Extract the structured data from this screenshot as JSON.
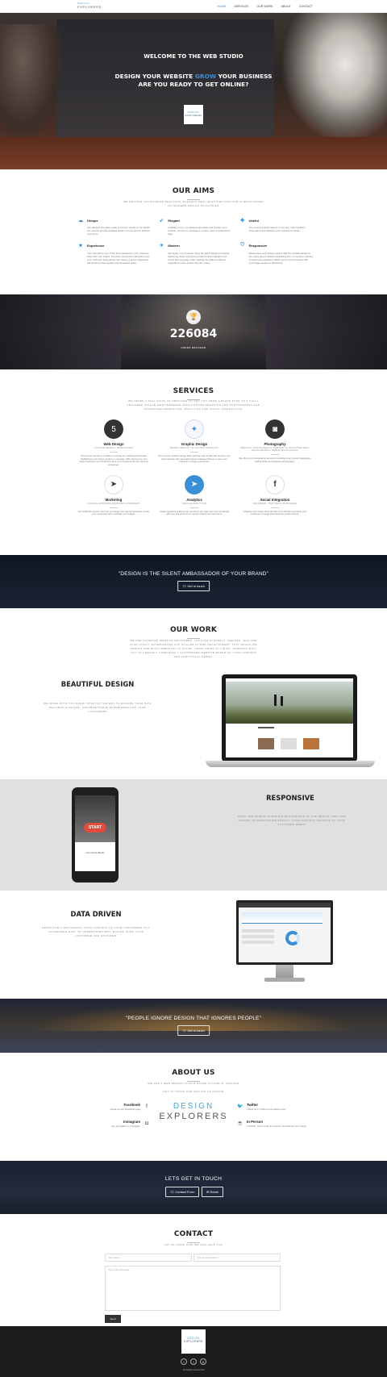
{
  "nav": {
    "logo_line1": "DESIGN",
    "logo_line2": "EXPLORERS",
    "items": [
      "HOME",
      "SERVICES",
      "OUR WORK",
      "ABOUT",
      "CONTACT"
    ]
  },
  "hero": {
    "welcome": "WELCOME TO THE WEB STUDIO",
    "line1_a": "DESIGN YOUR WEBSITE ",
    "line1_hl": "GROW",
    "line1_b": " YOUR BUSINESS",
    "line2": "ARE YOU READY TO GET ONLINE?",
    "logo_line1": "DESIGN",
    "logo_line2": "EXPLORERS"
  },
  "aims": {
    "title": "OUR AIMS",
    "subtitle": "WE DELIVER TAILOR MADE BEAUTIFUL ELEGANT WEB IDENTITIES FOR OUR CLIENTS BASED ON MODERN DESIGN PRINCIPLES",
    "items": [
      {
        "icon": "cloud-icon",
        "title": "Unique",
        "text": "Our designs are tailor made to suit the needs of our clients, our experts provide detailed advice on how best to achieve your aims."
      },
      {
        "icon": "rocket-icon",
        "title": "Elegant",
        "text": "Usability is key, our designs are clean and present your product, service or message in a clear easy to understand way."
      },
      {
        "icon": "useful-icon",
        "title": "Useful",
        "text": "The most important aspect to any site, that it delivers information and satisfies your customers needs."
      },
      {
        "icon": "star-icon",
        "title": "Experience",
        "text": "Your site will be one of the first interactions your customer have with your brand. The user experience will define how your customer feels about your brand. A great experience will develop brand loyalty and increased sales."
      },
      {
        "icon": "plane-icon",
        "title": "Modern",
        "text": "We deploy our products using the latest design principles, delivering clean responsive products that highlight your brand and message while ranking the widest audience regardless of the device they are using."
      },
      {
        "icon": "shield-icon",
        "title": "Responsive",
        "text": "Responsive web design means that the website adapts to the users device without sacrificing form or function. Having a responsive website enables you to communicate with your target audience effectively."
      }
    ]
  },
  "counter": {
    "number": "226084",
    "label": "USERS REACHED"
  },
  "services": {
    "title": "SERVICES",
    "subtitle": "WE OFFER A FULL SUITE OF SERVICES TO GET YOU FROM A BLANK PAGE TO A FULLY FEATURED UNIQUE WEB PRESENCE WITH CUSTOM GRAPHICS AND PHOTOGRAPHY AND INTEGRATED MARKETING, ANALYTICS AND SOCIAL INTERACTION.",
    "items": [
      {
        "icon": "html5-icon",
        "name": "Web Design",
        "tag": "CUSTOM DESIGN, RESPONSIVE",
        "text": "Our primary service is to deliver a unique eye catching and design highlighting your brand, product or message. With advice from our expert designers we will ensure all of your requirements are met and surpassed."
      },
      {
        "icon": "design-icon",
        "name": "Graphic Design",
        "tag": "BRAND IDENTITY & CUSTOM GRAPHICS",
        "text": "Our in house graphic design team will help your create and develop your brand identity. We can build custom interface features to give your customer a unique experience."
      },
      {
        "icon": "camera-icon",
        "name": "Photography",
        "tag": "PRODUCT PHOTOGRAPHY, PORTRAITS, ARCHITECTURAL PHOTOGRAPHY, AERIAL RETOUCHING",
        "text": "We offer a full photography service for creating your product catalogues, staff portraits and business photography."
      },
      {
        "icon": "marketing-icon",
        "name": "Marketing",
        "tag": "GOOGLE ADWORDS MANAGED CAMPAIGNS",
        "text": "Our AdWords experts can help you target your desired audience create your campaigns and message your budget."
      },
      {
        "icon": "analytics-icon",
        "name": "Analytics",
        "tag": "GOOGLE ANALYTICS",
        "text": "Using integrated analytics we can show you how users are interacting with your site and how to convert visitors into customers."
      },
      {
        "icon": "facebook-icon",
        "name": "Social Integration",
        "tag": "FACEBOOK, TWITTER & INSTAGRAM",
        "text": "Integrate your social accounts with your website and reach your customers through their favourite social network."
      }
    ]
  },
  "quote1": {
    "text": "\"DESIGN IS THE SILENT AMBASSADOR OF YOUR BRAND\"",
    "button": "Get in touch"
  },
  "work": {
    "title": "OUR WORK",
    "subtitle": "WE ARE TALENTED WEBSITE DESIGNERS, LOCATED IN DUBLIN, IRELAND, WHO ARE ALSO HIGHLY EXPERIENCED AND SKILLED IN WEB DEVELOPMENT. THAT MEANS WE DESIGN AND BUILD WEBSITES IN HOUSE, FROM START TO FINISH, WORKING WITH YOU TO CREATE A COMPLETELY CUSTOMIZED WEBSITE BASED ON YOUR CONTENT AND FUNCTIONAL NEEDS.",
    "bd_title": "BEAUTIFUL DESIGN",
    "bd_text": "WE WORK WITH YOU EVERY STEP OF THE WAY TO ENSURE YOUR SITE DELIVERS A UNIQUE, UNFORGETTABLE EXPERIENCE FOR YOUR CUSTOMERS"
  },
  "responsive": {
    "title": "RESPONSIVE",
    "text": "WHEN THE WIDEST AUDIENCE REGARDLESS OF THE DEVICE THEY USE THANKS TO RESPONSIVE DESIGN, YOUR CONTENT ADJUSTS TO YOUR CUSTOMER NEEDS",
    "phone_button": "START",
    "phone_caption": "Let's Get Its Results"
  },
  "data_driven": {
    "title": "DATA DRIVEN",
    "text": "EFFECTIVELY DELIVERING YOUR CONTENT TO YOUR CUSTOMERS IN A ACCESSIBLE EASY TO UNDERSTAND WAY, MAKING SURE YOUR CUSTOMER ARE SATISFIED"
  },
  "quote2": {
    "text": "\"PEOPLE IGNORE DESIGN THAT IGNORES PEOPLE\"",
    "button": "Get in touch"
  },
  "about": {
    "title": "ABOUT US",
    "subtitle1": "WE ARE A WEB DESIGN STUDIO BASED IN DUBLIN, IRELAND",
    "subtitle2": "GET IN TOUCH AND FOLLOW US ONLINE",
    "facebook": {
      "title": "Facebook",
      "text": "Check out our Facebook page"
    },
    "instagram": {
      "title": "Instagram",
      "text": "See our gallery on Instagram"
    },
    "twitter": {
      "title": "Twitter",
      "text": "Follow us on Twitter for the latest news"
    },
    "inperson": {
      "title": "In Person",
      "text": "In Dublin. Come meet us in person and discuss your project"
    },
    "logo_line1": "DESIGN",
    "logo_line2": "EXPLORERS"
  },
  "band": {
    "title": "LETS GET IN TOUCH",
    "btn_form": "Contact Form",
    "btn_email": "Email"
  },
  "contact": {
    "title": "CONTACT",
    "subtitle": "LET US KNOW HOW WE CAN HELP YOU",
    "name_placeholder": "Your Name *",
    "email_placeholder": "Your Email Address *",
    "message_placeholder": "Type your Message *",
    "send": "Send"
  },
  "footer": {
    "logo_line1": "DESIGN",
    "logo_line2": "EXPLORERS",
    "social": [
      "facebook-icon",
      "twitter-icon",
      "instagram-icon"
    ],
    "copyright": "All Rights Reserved"
  }
}
